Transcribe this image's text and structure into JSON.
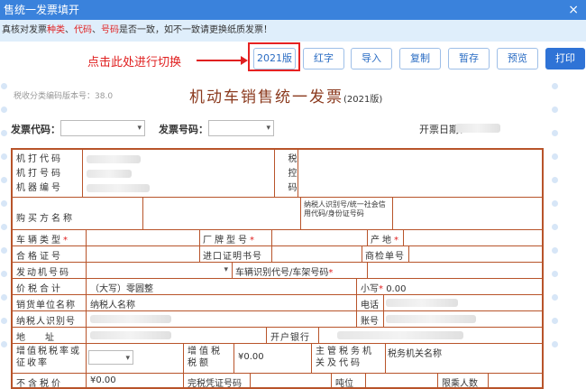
{
  "window": {
    "title": "售统一发票填开",
    "close": "×"
  },
  "notice": {
    "prefix": "真核对发票",
    "kind": "种类",
    "sep1": "、",
    "code": "代码",
    "sep2": "、",
    "number": "号码",
    "suffix": "是否一致，如不一致请更换纸质发票！"
  },
  "toolbar": {
    "version_btn": "2021版",
    "red_btn": "红字",
    "import_btn": "导入",
    "copy_btn": "复制",
    "save_btn": "暂存",
    "preview_btn": "预览",
    "print_btn": "打印"
  },
  "annotation": "点击此处进行切换",
  "form": {
    "version_text": "税收分类编码版本号：38.0",
    "title": "机动车销售统一发票",
    "title_version": "(2021版)",
    "invoice_code_label": "发票代码：",
    "invoice_number_label": "发票号码：",
    "issue_date_label": "开票日期："
  },
  "grid": {
    "machine_code": "机打代码",
    "machine_number": "机打号码",
    "machine_id": "机器编号",
    "tax_control": "税控码",
    "buyer_name": "购买方名称",
    "buyer_taxid": "纳税人识别号/统一社会信用代码/身份证号码",
    "vehicle_type": "车辆类型",
    "brand_model": "厂牌型号",
    "origin": "产地",
    "certificate_no": "合格证号",
    "import_cert": "进口证明书号",
    "inspection_no": "商检单号",
    "engine_no": "发动机号码",
    "vin": "车辆识别代号/车架号码",
    "total_label": "价税合计",
    "total_upper": "（大写）零圆整",
    "small_label": "小写",
    "small_value": "0.00",
    "seller_name_label": "销货单位名称",
    "seller_name_value": "纳税人名称",
    "phone_label": "电话",
    "taxid_label": "纳税人识别号",
    "account_label": "账号",
    "address_label": "地址",
    "bank_label": "开户银行",
    "vat_rate_label": "增值税税率或征收率",
    "vat_amount_label": "增值税税额",
    "vat_amount_value": "¥0.00",
    "tax_office_label": "主管税务机关及代码",
    "tax_office_value": "税务机关名称",
    "excl_tax_label": "不含税价",
    "excl_tax_value": "¥0.00",
    "tax_cert_label": "完税凭证号码",
    "tonnage_label": "吨位",
    "passenger_label": "限乘人数"
  }
}
